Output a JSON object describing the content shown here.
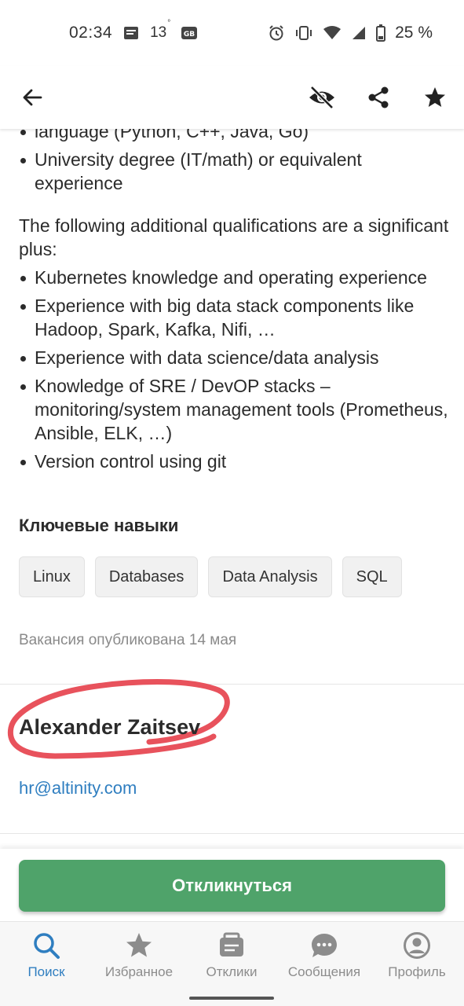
{
  "status_bar": {
    "time": "02:34",
    "temperature": "13",
    "degree": "°",
    "battery": "25 %"
  },
  "description": {
    "top_bullets": [
      "language (Python, C++, Java, Go)",
      "University degree (IT/math) or equivalent experience"
    ],
    "plus_intro": "The following additional qualifications are a significant plus:",
    "plus_bullets": [
      "Kubernetes knowledge and operating experience",
      "Experience with big data stack components like Hadoop, Spark, Kafka, Nifi, …",
      "Experience with data science/data analysis",
      "Knowledge of SRE / DevOP stacks – monitoring/system management tools (Prometheus, Ansible, ELK, …)",
      "Version control using git"
    ]
  },
  "skills": {
    "title": "Ключевые навыки",
    "chips": [
      "Linux",
      "Databases",
      "Data Analysis",
      "SQL"
    ]
  },
  "published": "Вакансия опубликована 14 мая",
  "contact": {
    "name": "Alexander Zaitsev",
    "email": "hr@altinity.com",
    "annotation_color": "#e8525c"
  },
  "apply_button": {
    "label": "Откликнуться",
    "color": "#4fa36a"
  },
  "bottom_nav": [
    {
      "label": "Поиск",
      "icon": "search-icon",
      "active": true
    },
    {
      "label": "Избранное",
      "icon": "star-icon",
      "active": false
    },
    {
      "label": "Отклики",
      "icon": "responses-icon",
      "active": false
    },
    {
      "label": "Сообщения",
      "icon": "chat-icon",
      "active": false
    },
    {
      "label": "Профиль",
      "icon": "profile-icon",
      "active": false
    }
  ],
  "colors": {
    "accent": "#2f7ec0",
    "primary_green": "#4fa36a",
    "text": "#2b2b2b"
  }
}
